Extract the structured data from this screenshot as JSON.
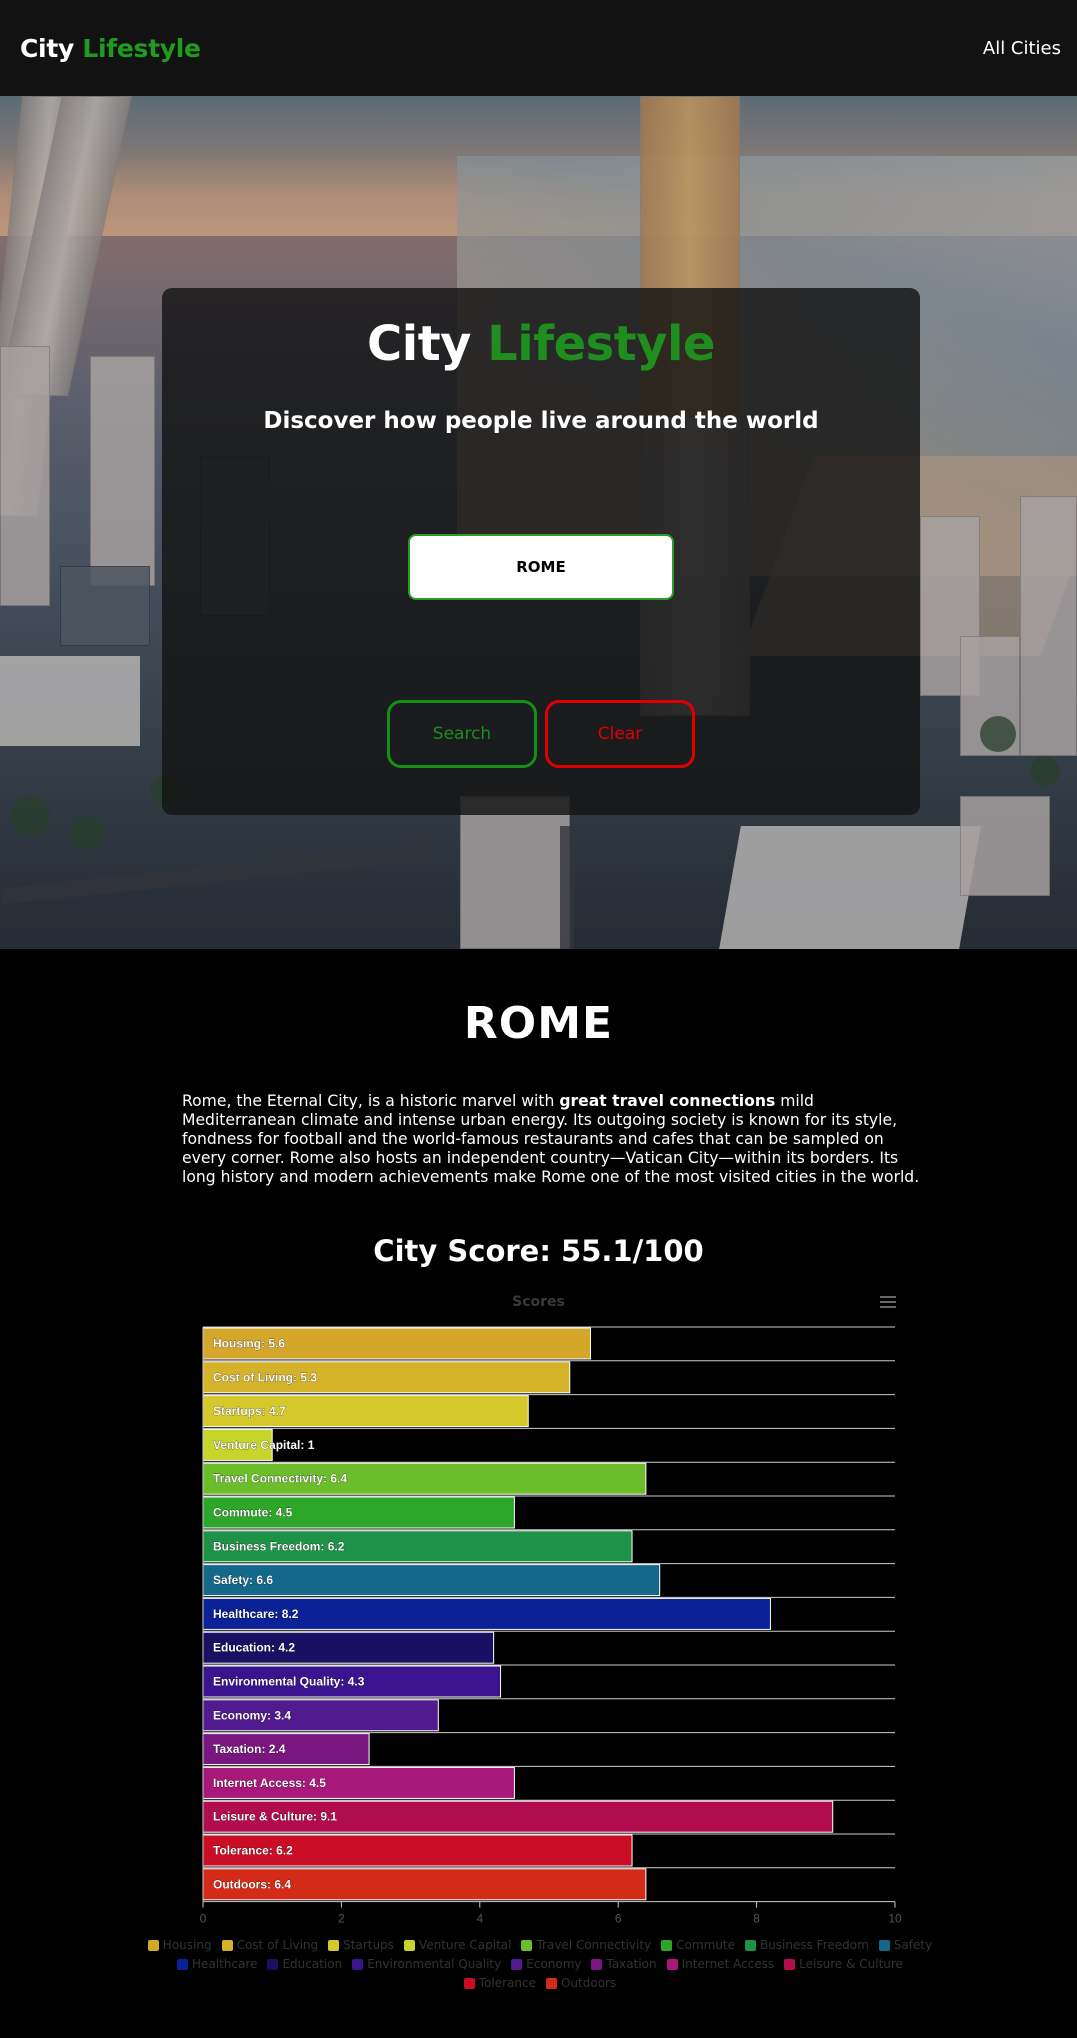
{
  "nav": {
    "brand_first": "City",
    "brand_second": "Lifestyle",
    "link": "All Cities"
  },
  "hero": {
    "title_first": "City",
    "title_second": "Lifestyle",
    "subtitle": "Discover how people live around the world",
    "input_value": "ROME",
    "search_label": "Search",
    "clear_label": "Clear"
  },
  "city": {
    "name": "ROME",
    "desc_before": "Rome, the Eternal City, is a historic marvel with ",
    "desc_bold": "great travel connections",
    "desc_after": " mild Mediterranean climate and intense urban energy. Its outgoing society is known for its style, fondness for football and the world-famous restaurants and cafes that can be sampled on every corner. Rome also hosts an independent country—Vatican City—within its borders. Its long history and modern achievements make Rome one of the most visited cities in the world.",
    "score_text": "City Score: 55.1/100"
  },
  "chart_data": {
    "type": "bar",
    "orientation": "horizontal",
    "title": "Scores",
    "xlim": [
      0,
      10
    ],
    "xticks": [
      0,
      2,
      4,
      6,
      8,
      10
    ],
    "legend_position": "bottom",
    "grid": false,
    "categories": [
      "Housing",
      "Cost of Living",
      "Startups",
      "Venture Capital",
      "Travel Connectivity",
      "Commute",
      "Business Freedom",
      "Safety",
      "Healthcare",
      "Education",
      "Environmental Quality",
      "Economy",
      "Taxation",
      "Internet Access",
      "Leisure & Culture",
      "Tolerance",
      "Outdoors"
    ],
    "values": [
      5.6,
      5.3,
      4.7,
      1,
      6.4,
      4.5,
      6.2,
      6.6,
      8.2,
      4.2,
      4.3,
      3.4,
      2.4,
      4.5,
      9.1,
      6.2,
      6.4
    ],
    "colors": [
      "#d4a62a",
      "#d4b32a",
      "#d4c82a",
      "#c7d42a",
      "#6bbd2a",
      "#2ea62a",
      "#1e9348",
      "#14688a",
      "#0a2296",
      "#191064",
      "#3a148f",
      "#521a8f",
      "#7a1680",
      "#a8177a",
      "#b10d4e",
      "#c80d25",
      "#d42a18"
    ]
  }
}
